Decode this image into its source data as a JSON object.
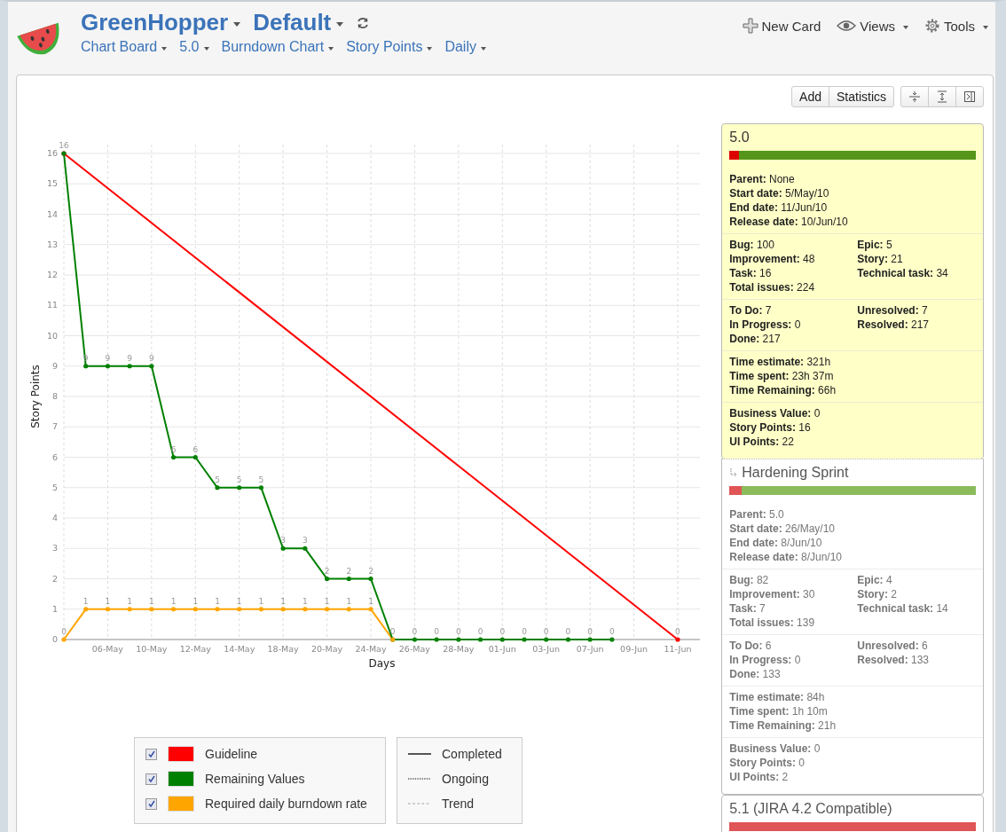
{
  "header": {
    "title": "GreenHopper",
    "board": "Default",
    "nav": [
      {
        "label": "Chart Board"
      },
      {
        "label": "5.0"
      },
      {
        "label": "Burndown Chart"
      },
      {
        "label": "Story Points"
      },
      {
        "label": "Daily"
      }
    ],
    "actions": [
      {
        "label": "New Card",
        "kind": "new",
        "dropdown": false
      },
      {
        "label": "Views",
        "kind": "views",
        "dropdown": true
      },
      {
        "label": "Tools",
        "kind": "tools",
        "dropdown": true
      }
    ]
  },
  "toolbar": {
    "buttons": [
      "Add",
      "Statistics"
    ],
    "icon_buttons": [
      {
        "kind": "collapse"
      },
      {
        "kind": "expand"
      },
      {
        "kind": "panel"
      }
    ]
  },
  "chart": {
    "chart_data": {
      "type": "line",
      "xlabel": "Days",
      "ylabel": "Story Points",
      "categories": [
        null,
        null,
        "06-May",
        null,
        "10-May",
        null,
        "12-May",
        null,
        "14-May",
        null,
        "18-May",
        null,
        "20-May",
        null,
        "24-May",
        null,
        "26-May",
        null,
        "28-May",
        null,
        "01-Jun",
        null,
        "03-Jun",
        null,
        "07-Jun",
        null,
        "09-Jun",
        null,
        "11-Jun"
      ],
      "yticks": [
        0,
        1,
        2,
        3,
        4,
        5,
        6,
        7,
        8,
        9,
        10,
        11,
        12,
        13,
        14,
        15,
        16
      ],
      "ylim": [
        0,
        16
      ],
      "grid": true,
      "value_labels": [
        [
          "16",
          null,
          null,
          null,
          null,
          null,
          null,
          null,
          null,
          null,
          null,
          null,
          null,
          null,
          null,
          null,
          null,
          null,
          null,
          null,
          null,
          null,
          null,
          null,
          null,
          null,
          null,
          null,
          "0"
        ],
        [
          null,
          "9",
          "9",
          "9",
          "9",
          "6",
          "6",
          "5",
          "5",
          "5",
          "3",
          "3",
          "2",
          "2",
          "2",
          "0",
          "0",
          "0",
          "0",
          "0",
          "0",
          "0",
          "0",
          "0",
          "0",
          "0",
          null,
          null,
          null
        ],
        [
          "0",
          "1",
          "1",
          "1",
          "1",
          "1",
          "1",
          "1",
          "1",
          "1",
          "1",
          "1",
          "1",
          "1",
          "1",
          null,
          null,
          null,
          null,
          null,
          null,
          null,
          null,
          null,
          null,
          null,
          null,
          null,
          null
        ]
      ],
      "series": [
        {
          "name": "Guideline",
          "color": "#ff0000",
          "values": [
            16,
            null,
            null,
            null,
            null,
            null,
            null,
            null,
            null,
            null,
            null,
            null,
            null,
            null,
            null,
            null,
            null,
            null,
            null,
            null,
            null,
            null,
            null,
            null,
            null,
            null,
            null,
            null,
            0
          ]
        },
        {
          "name": "Remaining Values",
          "color": "#008000",
          "values": [
            16,
            9,
            9,
            9,
            9,
            6,
            6,
            5,
            5,
            5,
            3,
            3,
            2,
            2,
            2,
            0,
            0,
            0,
            0,
            0,
            0,
            0,
            0,
            0,
            0,
            0,
            null,
            null,
            null
          ]
        },
        {
          "name": "Required daily burndown rate",
          "color": "#ffa500",
          "values": [
            0,
            1,
            1,
            1,
            1,
            1,
            1,
            1,
            1,
            1,
            1,
            1,
            1,
            1,
            1,
            0,
            null,
            null,
            null,
            null,
            null,
            null,
            null,
            null,
            null,
            null,
            null,
            null,
            null
          ]
        }
      ]
    }
  },
  "legend": {
    "series": [
      {
        "checked": true
      },
      {
        "checked": true
      },
      {
        "checked": true
      }
    ],
    "styles": [
      {
        "label": "Completed",
        "kind": "solid"
      },
      {
        "label": "Ongoing",
        "kind": "dotted"
      },
      {
        "label": "Trend",
        "kind": "dashed"
      }
    ]
  },
  "cards": [
    {
      "title": "5.0",
      "kind": "version",
      "selected": true,
      "level": 0.96,
      "sections": [
        {
          "left": [
            "**Parent:** None",
            "**Start date:** 5/May/10",
            "**End date:** 11/Jun/10",
            "**Release date:** 10/Jun/10"
          ]
        },
        {
          "left": [
            "**Bug:** 100",
            "**Improvement:** 48",
            "**Task:** 16",
            "**Total issues:** 224"
          ],
          "right": [
            "**Epic:** 5",
            "**Story:** 21",
            "**Technical task:** 34"
          ]
        },
        {
          "left": [
            "**To Do:** 7",
            "**In Progress:** 0",
            "**Done:** 217"
          ],
          "right": [
            "**Unresolved:** 7",
            "**Resolved:** 217"
          ]
        },
        {
          "left": [
            "**Time estimate:** 321h",
            "**Time spent:** 23h 37m",
            "**Time Remaining:** 66h"
          ]
        },
        {
          "left": [
            "**Business Value:** 0",
            "**Story Points:** 16",
            "**UI Points:** 22"
          ]
        }
      ]
    },
    {
      "title": "Hardening Sprint",
      "kind": "sprint",
      "selected": false,
      "level": 0.95,
      "sections": [
        {
          "left": [
            "**Parent:** 5.0",
            "**Start date:** 26/May/10",
            "**End date:** 8/Jun/10",
            "**Release date:** 8/Jun/10"
          ]
        },
        {
          "left": [
            "**Bug:** 82",
            "**Improvement:** 30",
            "**Task:** 7",
            "**Total issues:** 139"
          ],
          "right": [
            "**Epic:** 4",
            "**Story:** 2",
            "**Technical task:** 14"
          ]
        },
        {
          "left": [
            "**To Do:** 6",
            "**In Progress:** 0",
            "**Done:** 133"
          ],
          "right": [
            "**Unresolved:** 6",
            "**Resolved:** 133"
          ]
        },
        {
          "left": [
            "**Time estimate:** 84h",
            "**Time spent:** 1h 10m",
            "**Time Remaining:** 21h"
          ]
        },
        {
          "left": [
            "**Business Value:** 0",
            "**Story Points:** 0",
            "**UI Points:** 2"
          ]
        }
      ]
    },
    {
      "title": "5.1 (JIRA 4.2 Compatible)",
      "kind": "version",
      "selected": false,
      "level": 0
    }
  ]
}
